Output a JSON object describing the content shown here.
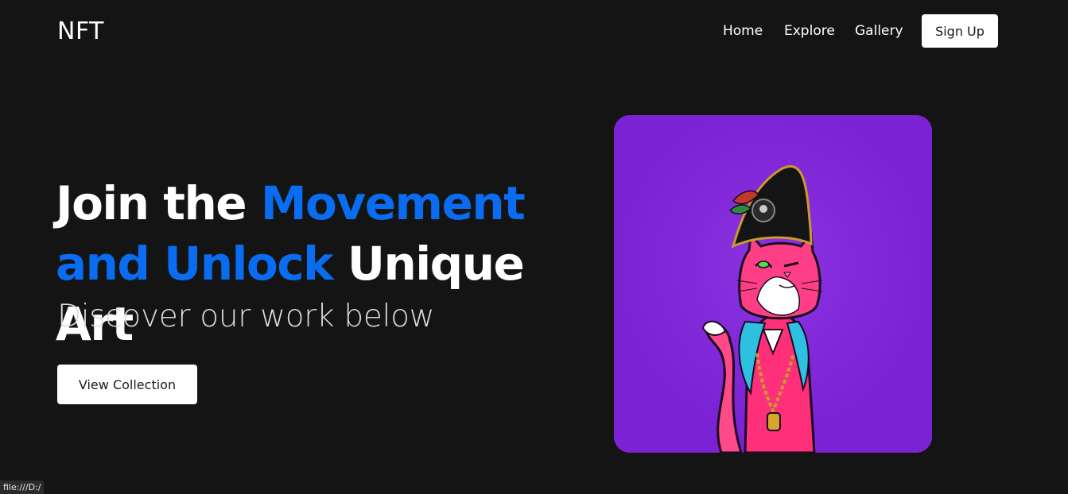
{
  "navbar": {
    "logo": "NFT",
    "links": [
      "Home",
      "Explore",
      "Gallery"
    ],
    "signup_label": "Sign Up"
  },
  "hero": {
    "title_part1": "Join the ",
    "title_part2": "Movement",
    "title_part3": "and Unlock",
    "title_part4": " Unique Art",
    "subtitle": "Discover our work below",
    "cta_label": "View Collection"
  },
  "colors": {
    "background": "#141414",
    "accent": "#0a6cf0",
    "card": "#7b22d4"
  },
  "status_bar": {
    "url": "file:///D:/"
  }
}
